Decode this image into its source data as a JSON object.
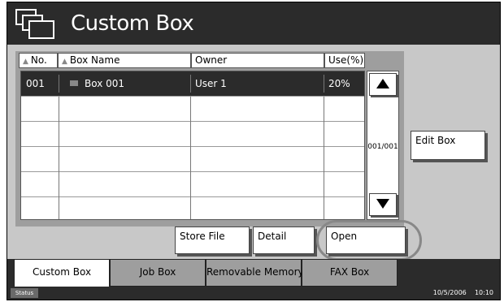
{
  "window": {
    "title": "Custom Box"
  },
  "list": {
    "headers": {
      "no": "No.",
      "name": "Box Name",
      "owner": "Owner",
      "use": "Use(%)"
    },
    "rows": [
      {
        "no": "001",
        "name": "Box 001",
        "owner": "User 1",
        "use": "20%"
      }
    ],
    "page": "001/001"
  },
  "buttons": {
    "edit_box": "Edit Box",
    "store_file": "Store File",
    "detail": "Detail",
    "open": "Open"
  },
  "tabs": [
    {
      "label": "Custom Box",
      "active": true
    },
    {
      "label": "Job Box",
      "active": false
    },
    {
      "label": "Removable Memory",
      "active": false
    },
    {
      "label": "FAX Box",
      "active": false
    }
  ],
  "status": {
    "label": "Status",
    "date": "10/5/2006",
    "time": "10:10"
  },
  "colors": {
    "title_bar": "#2b2b2b",
    "panel": "#c8c8c8",
    "selected_row": "#2b2b2b",
    "inactive_tab": "#9e9e9e"
  }
}
